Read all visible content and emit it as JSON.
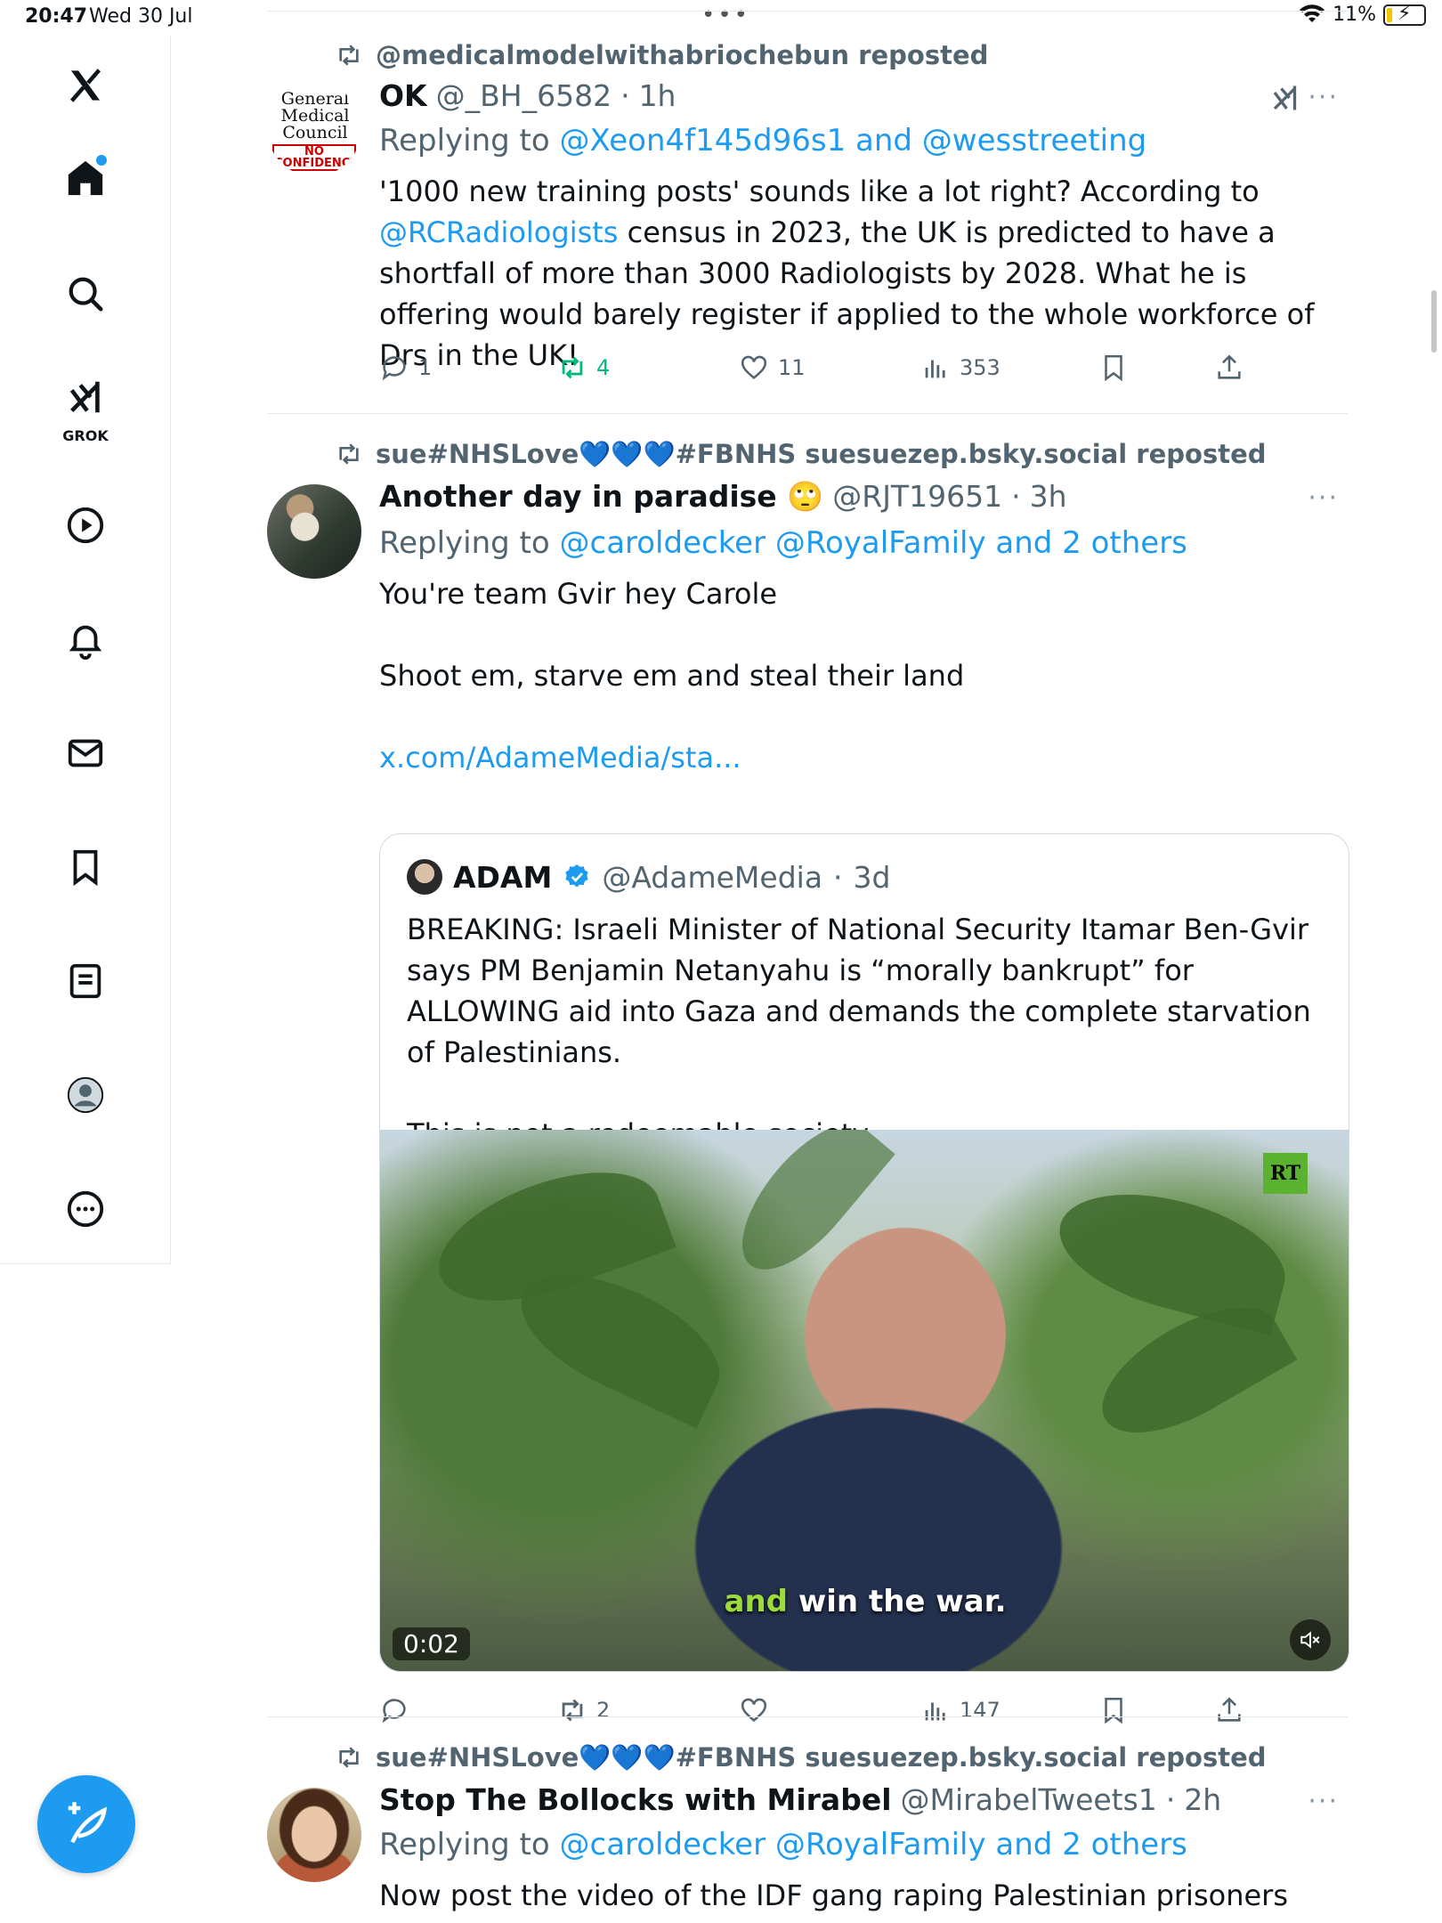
{
  "status_bar": {
    "time": "20:47",
    "date": "Wed 30 Jul",
    "battery": "11%"
  },
  "sidebar": {
    "grok_label": "GROK",
    "items": [
      "x-logo-icon",
      "home-icon",
      "search-icon",
      "grok-icon",
      "video-icon",
      "notifications-icon",
      "messages-icon",
      "bookmarks-icon",
      "lists-icon",
      "profile-icon",
      "more-icon"
    ]
  },
  "colors": {
    "accent": "#1d9bf0",
    "muted": "#536471",
    "repost_green": "#00ba7c"
  },
  "tweets": [
    {
      "reposted_by": "@medicalmodelwithabriochebun reposted",
      "name": "OK",
      "handle": "@_BH_6582",
      "time": "1h",
      "replying_prefix": "Replying to",
      "replying_to": "@Xeon4f145d96s1 and @wesstreeting",
      "text_1": "'1000 new training posts' sounds like a lot right? According to",
      "text_mention": "@RCRadiologists",
      "text_2": "census in 2023, the UK is predicted to have a shortfall of more than 3000 Radiologists by 2028. What he is offering would barely register if applied to the whole workforce of Drs in the UK!",
      "avatar_text": [
        "General",
        "Medical",
        "Council",
        "NO",
        "CONFIDENCE"
      ],
      "replies": "1",
      "reposts": "4",
      "likes": "11",
      "views": "353"
    },
    {
      "reposted_by": "sue#NHSLove💙💙💙#FBNHS suesuezep.bsky.social reposted",
      "name": "Another day in paradise 🙄",
      "handle": "@RJT19651",
      "time": "3h",
      "replying_prefix": "Replying to",
      "replying_to": "@caroldecker @RoyalFamily and 2 others",
      "text_line_1": "You're team Gvir hey Carole",
      "text_line_2": "Shoot em, starve em and steal their land",
      "text_link": "x.com/AdameMedia/sta...",
      "quote": {
        "name": "ADAM",
        "handle": "@AdameMedia",
        "time": "3d",
        "text_1": "BREAKING: Israeli Minister of National Security Itamar Ben-Gvir says PM Benjamin Netanyahu is “morally bankrupt” for ALLOWING aid into Gaza and demands the complete starvation of Palestinians.",
        "text_2": "This is not a redeemable society.",
        "video_logo": "RT",
        "caption_hl": "and",
        "caption_rest": "win the war.",
        "timecode": "0:02"
      },
      "replies": "",
      "reposts": "2",
      "likes": "",
      "views": "147"
    },
    {
      "reposted_by": "sue#NHSLove💙💙💙#FBNHS suesuezep.bsky.social reposted",
      "name": "Stop The Bollocks with Mirabel",
      "handle": "@MirabelTweets1",
      "time": "2h",
      "replying_prefix": "Replying to",
      "replying_to": "@caroldecker @RoyalFamily and 2 others",
      "text": "Now post the video of the IDF gang raping Palestinian prisoners"
    }
  ]
}
